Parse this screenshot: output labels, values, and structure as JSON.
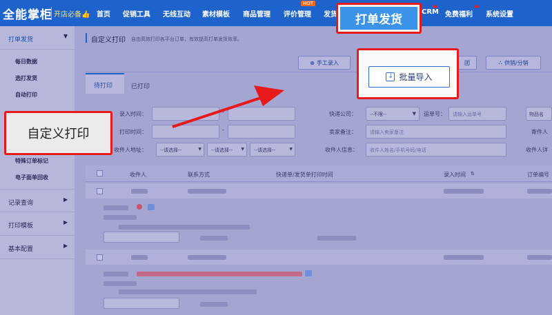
{
  "header": {
    "logo": "全能掌柜",
    "logo_sub": "开店必备👍",
    "nav": [
      "首页",
      "促销工具",
      "无线互动",
      "素材模板",
      "商品管理",
      "评价管理",
      "发货",
      "CRM",
      "免费福利",
      "系统设置"
    ],
    "hot_badge": "HOT"
  },
  "sidebar": {
    "sections": [
      "打单发货",
      "记录查询",
      "打印模板",
      "基本配置"
    ],
    "items": [
      "每日数据",
      "选打发货",
      "自动打印",
      "特殊订单标记",
      "电子面单回收"
    ]
  },
  "main": {
    "page_title": "自定义打印",
    "page_desc": "自由高效打印各平台订单，有效提高打单发货效率。",
    "tabs": [
      "待打印",
      "已打印"
    ],
    "buttons": {
      "manual": "手工录入",
      "supplier": "供销/分销",
      "partial": "团"
    },
    "filters": {
      "entry_time": "录入时间：",
      "print_time": "打印时间：",
      "address": "收件人地址：",
      "select_placeholder": "--请选择--",
      "dash": "-",
      "express_label": "快递公司：",
      "express_value": "--不限--",
      "waybill_label": "运单号：",
      "waybill_placeholder": "请输入运单号",
      "seller_note_label": "卖家备注：",
      "seller_note_placeholder": "请输入卖家备注",
      "recipient_label": "收件人信息：",
      "recipient_placeholder": "收件人姓名/手机号码/电话",
      "goods_label": "物品名",
      "sender_label": "寄件人",
      "recipient_detail_label": "收件人详"
    },
    "table_headers": [
      "收件人",
      "联系方式",
      "快递单/发货单打印时间",
      "录入时间",
      "订单编号"
    ]
  },
  "callouts": {
    "print_ship": "打单发货",
    "batch_import": "批量导入",
    "custom_print": "自定义打印"
  },
  "colors": {
    "callout_border": "#e61a1a",
    "topbar": "#1e63cc",
    "overlay": "#9696c6"
  }
}
